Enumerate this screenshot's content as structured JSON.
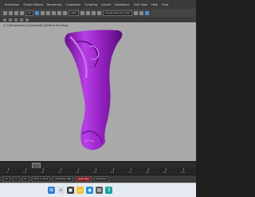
{
  "menubar": {
    "items": [
      "Animation",
      "Graph Editors",
      "Rendering",
      "Customize",
      "Scripting",
      "Arnold",
      "Substance",
      "Civil View",
      "Help",
      "Flow"
    ]
  },
  "toolbar": {
    "selection_set": "Create Selection Set",
    "view_dropdown": "View",
    "all_dropdown": "All"
  },
  "viewport": {
    "label": "[+] [Perspective] [Standard] [Default Shading]",
    "model_color": "#9a24c8",
    "background_color": "#a9a9a9"
  },
  "trackbar": {
    "frame_counter": "0 / 100"
  },
  "timeline": {
    "ticks": [
      "0",
      "10",
      "20",
      "30",
      "40",
      "50",
      "60",
      "70",
      "80",
      "90",
      "100"
    ]
  },
  "status": {
    "x": "X:",
    "y": "Y:",
    "z": "Z:",
    "grid": "Grid = 10.0",
    "add_time_tag": "Add Time Tag",
    "auto_key": "Auto Key",
    "selected": "Selected"
  },
  "taskbar": {
    "icons": [
      "start-icon",
      "search-icon",
      "task-view-icon",
      "file-explorer-icon",
      "browser-icon",
      "store-icon",
      "3dsmax-icon"
    ],
    "time": "",
    "date": ""
  }
}
